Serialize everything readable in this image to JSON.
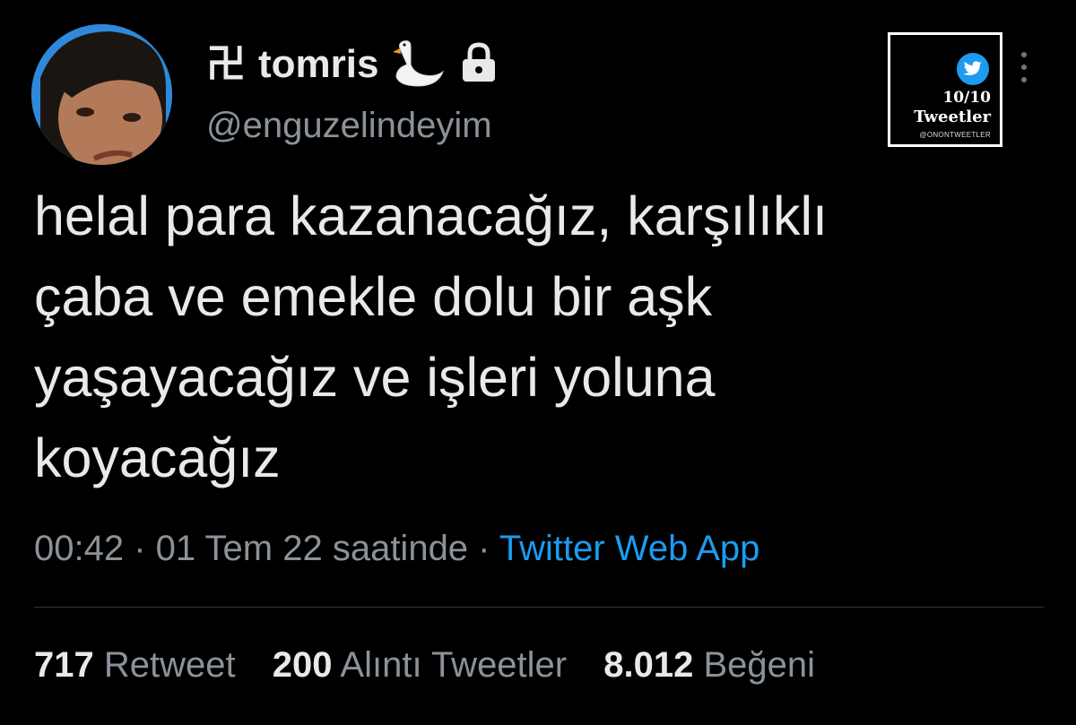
{
  "profile": {
    "name_symbol": "卍",
    "name": "tomris",
    "handle": "@enguzelindeyim",
    "emoji_icon": "swan-icon",
    "protected_icon": "lock-icon"
  },
  "badge": {
    "count": "10/10",
    "title": "Tweetler",
    "handle": "@ONONTWEETLER",
    "icon": "twitter-bird-icon"
  },
  "tweet": {
    "text": "helal para kazanacağız, karşılıklı\nçaba ve emekle dolu bir aşk\nyaşayacağız ve işleri yoluna\nkoyacağız"
  },
  "meta": {
    "time": "00:42",
    "separator": " · ",
    "date": "01 Tem 22 saatinde",
    "source": "Twitter Web App"
  },
  "stats": {
    "retweets": {
      "count": "717",
      "label": "Retweet"
    },
    "quotes": {
      "count": "200",
      "label": "Alıntı Tweetler"
    },
    "likes": {
      "count": "8.012",
      "label": "Beğeni"
    }
  },
  "colors": {
    "background": "#000000",
    "text": "#e7e9ea",
    "secondary": "#8b9299",
    "link": "#1d9bf0"
  }
}
